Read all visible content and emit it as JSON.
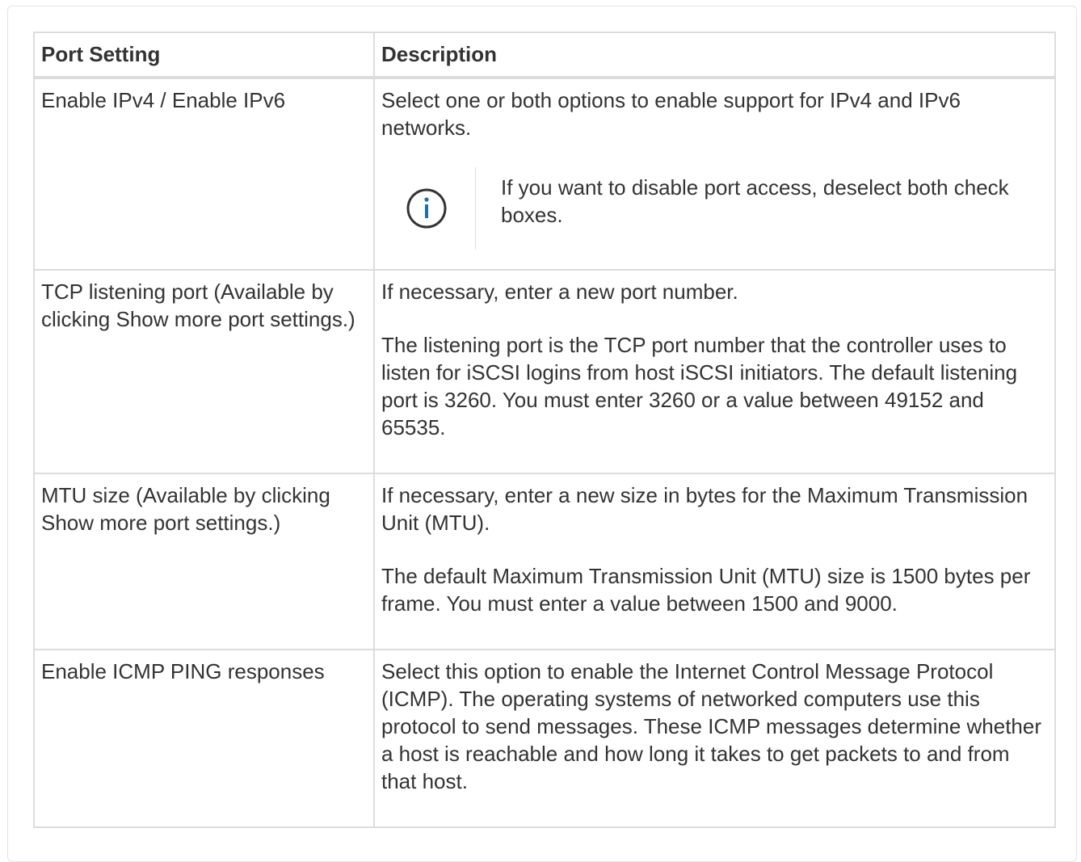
{
  "table": {
    "headers": {
      "setting": "Port Setting",
      "description": "Description"
    },
    "rows": [
      {
        "setting": "Enable IPv4 / Enable IPv6",
        "description": [
          "Select one or both options to enable support for IPv4 and IPv6 networks."
        ],
        "note": {
          "icon": "info-icon",
          "text": "If you want to disable port access, deselect both check boxes."
        }
      },
      {
        "setting": "TCP listening port (Available by clicking Show more port settings.)",
        "description": [
          "If necessary, enter a new port number.",
          "The listening port is the TCP port number that the controller uses to listen for iSCSI logins from host iSCSI initiators. The default listening port is 3260. You must enter 3260 or a value between 49152 and 65535."
        ]
      },
      {
        "setting": "MTU size (Available by clicking Show more port settings.)",
        "description": [
          "If necessary, enter a new size in bytes for the Maximum Transmission Unit (MTU).",
          "The default Maximum Transmission Unit (MTU) size is 1500 bytes per frame. You must enter a value between 1500 and 9000."
        ]
      },
      {
        "setting": "Enable ICMP PING responses",
        "description": [
          "Select this option to enable the Internet Control Message Protocol (ICMP). The operating systems of networked computers use this protocol to send messages. These ICMP messages determine whether a host is reachable and how long it takes to get packets to and from that host."
        ]
      }
    ]
  },
  "colors": {
    "text": "#333333",
    "border": "#dcdcdc",
    "info_icon": "#1a6fb5"
  }
}
